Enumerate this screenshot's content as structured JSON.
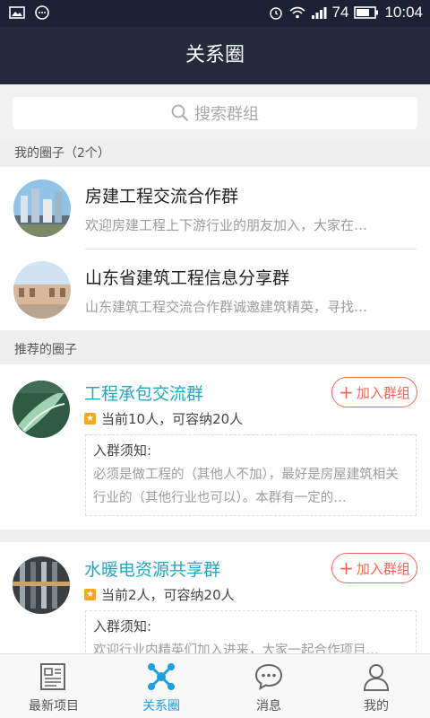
{
  "status": {
    "battery": "74",
    "time": "10:04"
  },
  "header": {
    "title": "关系圈"
  },
  "search": {
    "placeholder": "搜索群组"
  },
  "my_groups": {
    "header": "我的圈子（2个）",
    "items": [
      {
        "name": "房建工程交流合作群",
        "desc": "欢迎房建工程上下游行业的朋友加入，大家在…"
      },
      {
        "name": "山东省建筑工程信息分享群",
        "desc": "山东建筑工程交流合作群诚邀建筑精英，寻找…"
      }
    ]
  },
  "recommended": {
    "header": "推荐的圈子",
    "join_label": "加入群组",
    "notice_title": "入群须知:",
    "items": [
      {
        "name": "工程承包交流群",
        "count": "当前10人，可容纳20人",
        "notice": "必须是做工程的（其他人不加），最好是房屋建筑相关行业的（其他行业也可以）。本群有一定的…"
      },
      {
        "name": "水暖电资源共享群",
        "count": "当前2人，可容纳20人",
        "notice": "欢迎行业内精英们加入进来，大家一起合作项目…"
      }
    ]
  },
  "tabs": [
    {
      "label": "最新项目",
      "icon": "newspaper-icon",
      "active": false
    },
    {
      "label": "关系圈",
      "icon": "network-icon",
      "active": true
    },
    {
      "label": "消息",
      "icon": "chat-icon",
      "active": false
    },
    {
      "label": "我的",
      "icon": "person-icon",
      "active": false
    }
  ],
  "colors": {
    "header_bg": "#242b3d",
    "accent": "#1e9fe0",
    "group_name_rec": "#26a6bd",
    "join_button": "#e86a55"
  }
}
